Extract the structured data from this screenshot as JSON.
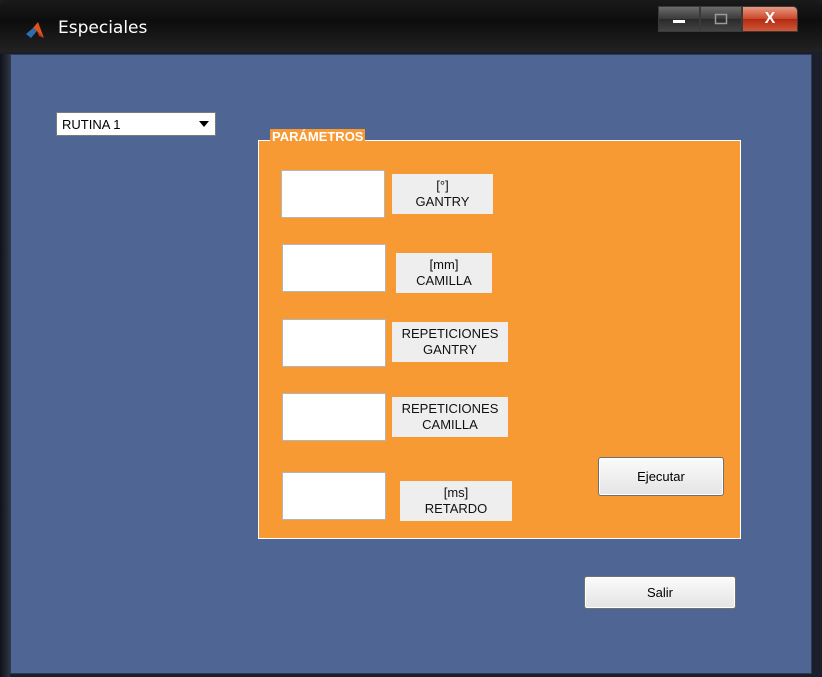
{
  "window": {
    "title": "Especiales",
    "close_symbol": "X"
  },
  "routine_select": {
    "selected": "RUTINA 1"
  },
  "parameters": {
    "title": "PARÁMETROS",
    "fields": [
      {
        "value": "",
        "unit": "[°]",
        "name": "GANTRY"
      },
      {
        "value": "",
        "unit": "[mm]",
        "name": "CAMILLA"
      },
      {
        "value": "",
        "unit": "REPETICIONES",
        "name": "GANTRY"
      },
      {
        "value": "",
        "unit": "REPETICIONES",
        "name": "CAMILLA"
      },
      {
        "value": "",
        "unit": "[ms]",
        "name": "RETARDO"
      }
    ],
    "execute_label": "Ejecutar"
  },
  "exit_label": "Salir",
  "colors": {
    "background": "#4f6695",
    "panel": "#f79a33"
  }
}
